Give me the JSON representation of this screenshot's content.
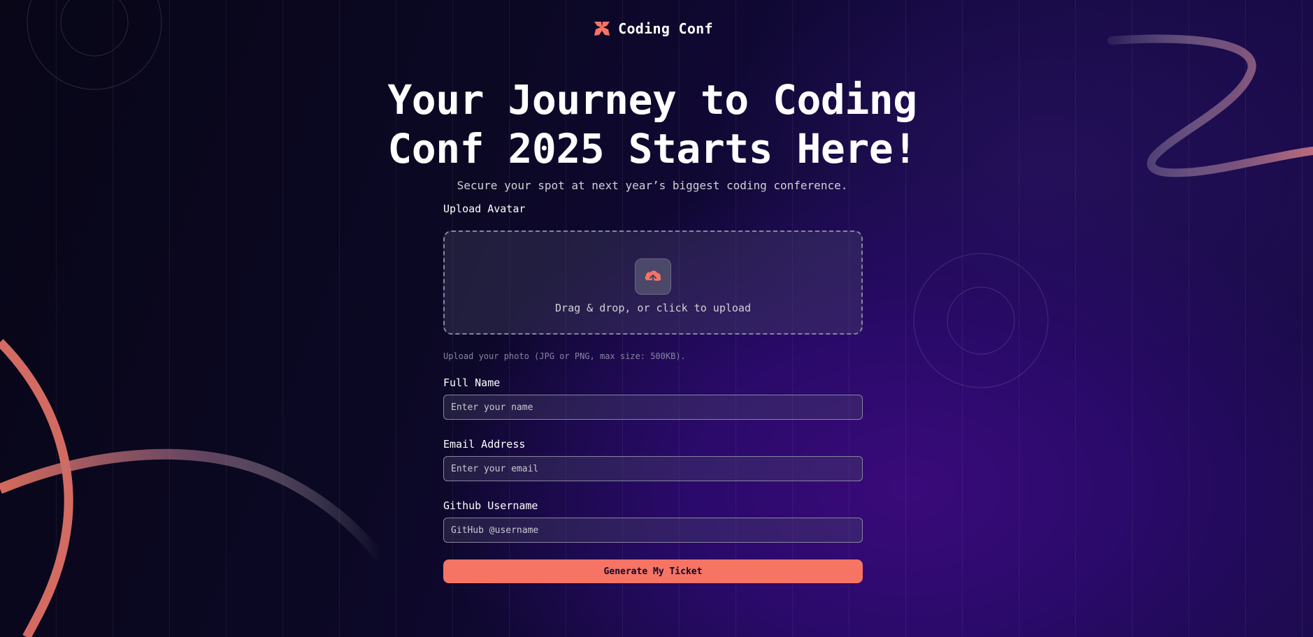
{
  "brand": {
    "name": "Coding Conf",
    "logo_icon": "coding-conf-logo-icon",
    "accent_color": "#f57463"
  },
  "hero": {
    "title": "Your Journey to Coding Conf 2025 Starts Here!",
    "subtitle": "Secure your spot at next year’s biggest coding conference."
  },
  "form": {
    "avatar": {
      "label": "Upload Avatar",
      "icon": "cloud-upload-icon",
      "drop_text": "Drag & drop, or click to upload",
      "hint": "Upload your photo (JPG or PNG, max size: 500KB)."
    },
    "full_name": {
      "label": "Full Name",
      "placeholder": "Enter your name",
      "value": ""
    },
    "email": {
      "label": "Email Address",
      "placeholder": "Enter your email",
      "value": ""
    },
    "github": {
      "label": "Github Username",
      "placeholder": "GitHub @username",
      "value": ""
    },
    "submit_label": "Generate My Ticket"
  },
  "colors": {
    "background_dark": "#0b0824",
    "background_purple": "#3a0a7a",
    "text_muted": "#d2d1d6",
    "input_border": "#8785a1"
  }
}
